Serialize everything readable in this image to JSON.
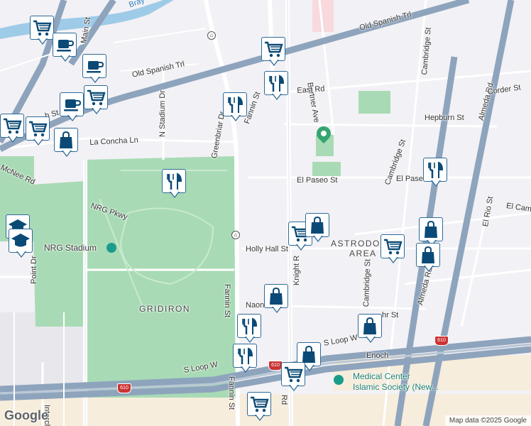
{
  "labels": {
    "old_spanish_trl_top": "Old Spanish Trl",
    "old_spanish_trl_left": "Old Spanish Trl",
    "main_st": "Main St",
    "bertner_ave": "Bertner Ave",
    "cambridge_st_top": "Cambridge St",
    "almeda_rd_top": "Almeda Rd",
    "corder_st": "Corder St",
    "east_rd": "East Rd",
    "hepburn_st": "Hepburn St",
    "fannin_st_top": "Fannin St",
    "greenbriar_dr": "Greenbriar Dr",
    "n_stadium_dr": "N Stadium Dr",
    "la_concha_ln": "La Concha Ln",
    "mcnee_rd": "McNee Rd",
    "h_st": "h St",
    "el_paseo_st": "El Paseo St",
    "el_pase_right": "El Pase",
    "cambridge_st_mid": "Cambridge St",
    "el_cam": "El Cam",
    "el_rio_st": "El Rio St",
    "nrg_pkwy": "NRG Pkwy",
    "nrg_stadium": "NRG Stadium",
    "point_dr": "Point Dr",
    "holly_hall_st": "Holly Hall St",
    "knight_rd": "Knight R",
    "astrodome_area_1": "ASTRODO",
    "astrodome_area_2": "AREA",
    "cambridge_st_low": "Cambridge St",
    "almeda_rd_low": "Almeda Rd",
    "fannin_st_mid": "Fannin St",
    "gridiron": "GRIDIRON",
    "naon": "Naon",
    "mohr_st": "hr St",
    "s_loop_w_right": "S Loop W",
    "s_loop_w_left": "S Loop W",
    "enoch": "Enoch",
    "medical_center_1": "Medical Center",
    "medical_center_2": "Islamic Society (New...",
    "fannin_st_low": "Fannin St",
    "rd_low": "Rd",
    "interchange": "Interch",
    "bray": "Bray"
  },
  "shields": {
    "i610_a": "610",
    "i610_b": "610",
    "i610_c": "610"
  },
  "attribution": "Map data ©2025 Google",
  "google_logo": "Google",
  "colors": {
    "park": "#a8dbb5",
    "highway": "#8ea4bd",
    "water": "#9ecbe8",
    "pin_border": "#2d6a98",
    "icon": "#0b4a76"
  },
  "markers": [
    {
      "type": "grocery-icon"
    },
    {
      "type": "coffee-icon"
    },
    {
      "type": "coffee-icon"
    },
    {
      "type": "grocery-icon"
    },
    {
      "type": "coffee-icon"
    },
    {
      "type": "grocery-icon"
    },
    {
      "type": "grocery-icon"
    },
    {
      "type": "shopping-bag-icon"
    },
    {
      "type": "grocery-icon"
    },
    {
      "type": "restaurant-icon"
    },
    {
      "type": "restaurant-icon"
    },
    {
      "type": "restaurant-icon"
    },
    {
      "type": "school-icon"
    },
    {
      "type": "school-icon"
    },
    {
      "type": "grocery-icon"
    },
    {
      "type": "shopping-bag-icon"
    },
    {
      "type": "restaurant-icon"
    },
    {
      "type": "shopping-bag-icon"
    },
    {
      "type": "grocery-icon"
    },
    {
      "type": "shopping-bag-icon"
    },
    {
      "type": "shopping-bag-icon"
    },
    {
      "type": "shopping-bag-icon"
    },
    {
      "type": "restaurant-icon"
    },
    {
      "type": "restaurant-icon"
    },
    {
      "type": "shopping-bag-icon"
    },
    {
      "type": "grocery-icon"
    },
    {
      "type": "grocery-icon"
    }
  ]
}
